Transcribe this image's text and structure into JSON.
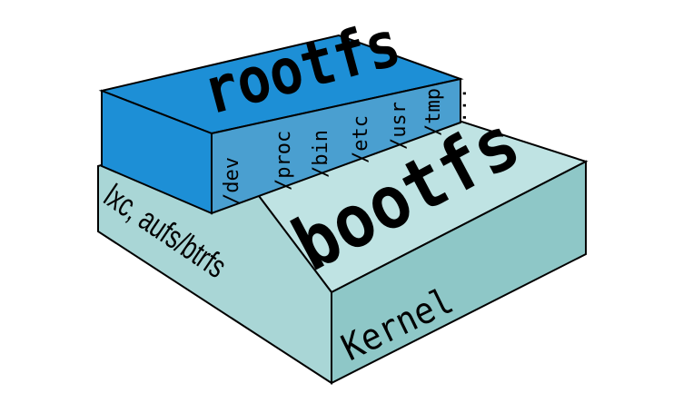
{
  "diagram": {
    "rootfs": {
      "title": "rootfs",
      "dirs": [
        "/dev",
        "/proc",
        "/bin",
        "/etc",
        "/usr",
        "/tmp",
        "..."
      ],
      "colors": {
        "top": "#1d8fd6",
        "front": "#1d8fd6",
        "side": "#4a9fd0"
      }
    },
    "bootfs": {
      "title": "bootfs",
      "side_label": "lxc, aufs/btrfs",
      "front_label": "Kernel",
      "colors": {
        "top": "#bfe3e3",
        "front": "#9ccfcf",
        "side": "#8ec7c7"
      }
    },
    "stroke_color": "#000000"
  }
}
